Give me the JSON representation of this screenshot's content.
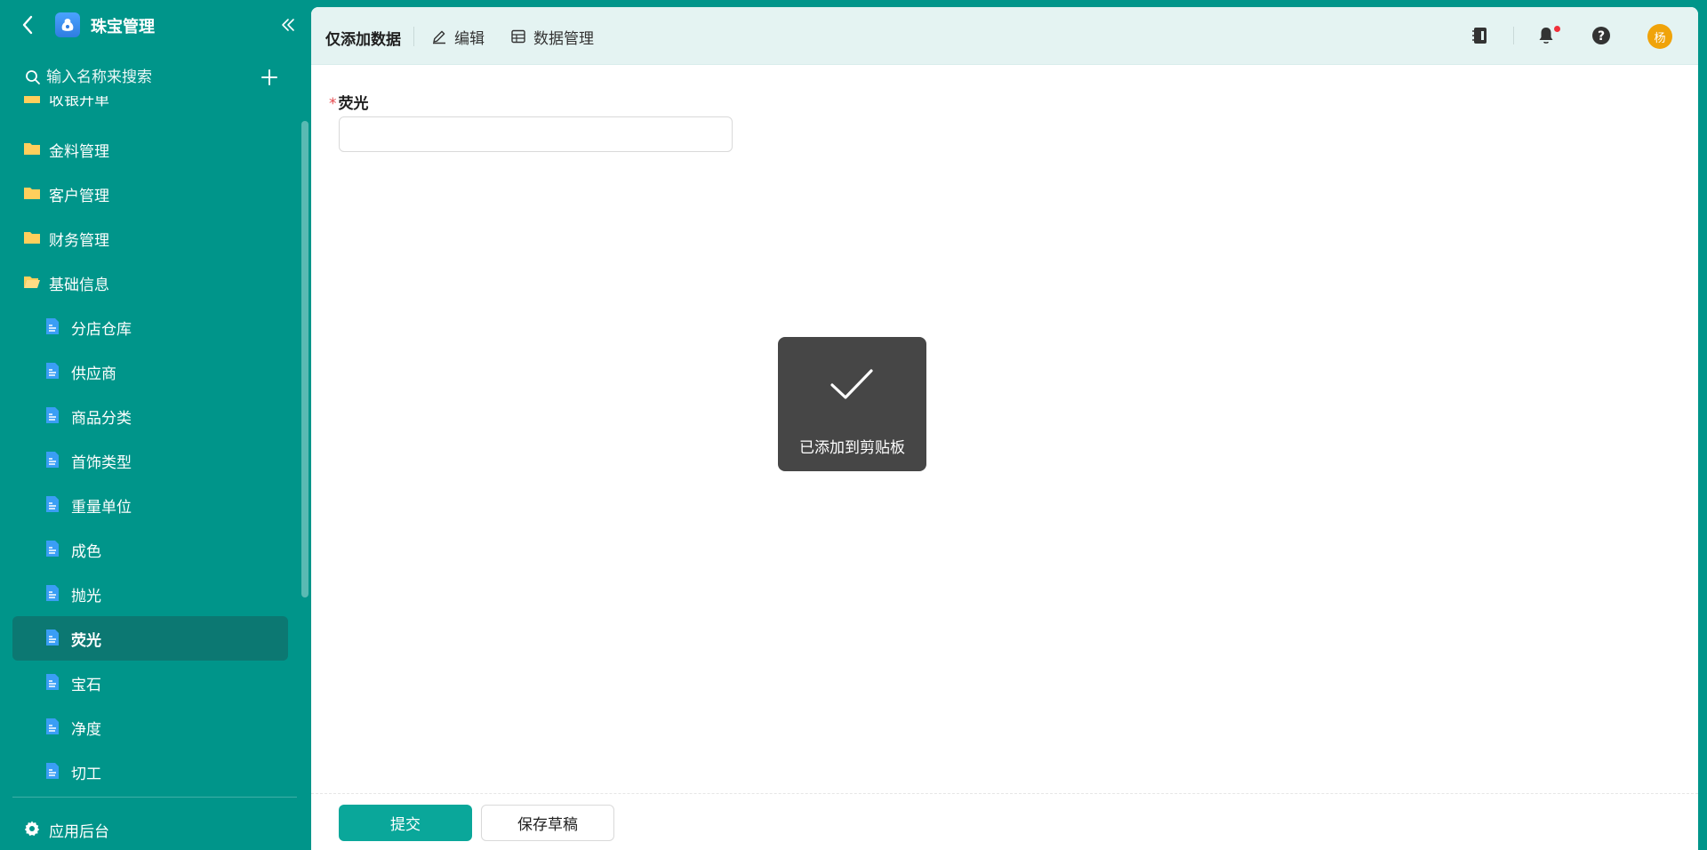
{
  "app": {
    "title": "珠宝管理"
  },
  "search": {
    "placeholder": "输入名称来搜索"
  },
  "sidebar": {
    "partial_item": "收银开单",
    "folders": [
      {
        "label": "金料管理"
      },
      {
        "label": "客户管理"
      },
      {
        "label": "财务管理"
      },
      {
        "label": "基础信息"
      }
    ],
    "pages": [
      {
        "label": "分店仓库"
      },
      {
        "label": "供应商"
      },
      {
        "label": "商品分类"
      },
      {
        "label": "首饰类型"
      },
      {
        "label": "重量单位"
      },
      {
        "label": "成色"
      },
      {
        "label": "抛光"
      },
      {
        "label": "荧光"
      },
      {
        "label": "宝石"
      },
      {
        "label": "净度"
      },
      {
        "label": "切工"
      }
    ],
    "active_page": "荧光",
    "settings_label": "应用后台"
  },
  "topbar": {
    "title": "仅添加数据",
    "edit_label": "编辑",
    "data_label": "数据管理",
    "avatar_text": "杨"
  },
  "form": {
    "field_label": "荧光",
    "required_mark": "*",
    "field_value": ""
  },
  "toast": {
    "message": "已添加到剪贴板"
  },
  "footer": {
    "submit_label": "提交",
    "draft_label": "保存草稿"
  },
  "colors": {
    "sidebar_bg": "#00958a",
    "active_item_bg": "#0c7872",
    "primary_button": "#0aa79a",
    "avatar_bg": "#f0a30a"
  }
}
